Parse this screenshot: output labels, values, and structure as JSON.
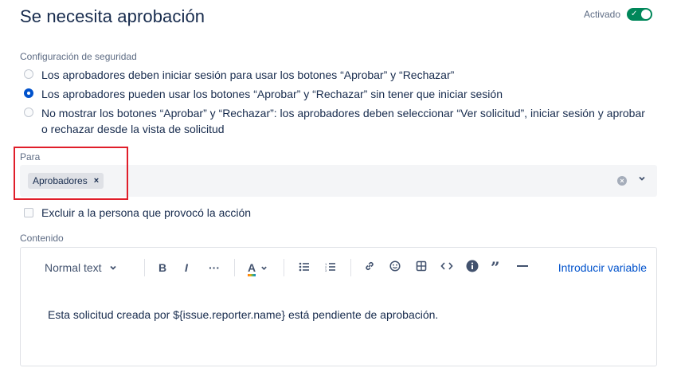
{
  "header": {
    "title": "Se necesita aprobación",
    "toggle_label": "Activado",
    "toggle_on": true
  },
  "security": {
    "label": "Configuración de seguridad",
    "options": [
      {
        "text": "Los aprobadores deben iniciar sesión para usar los botones “Aprobar” y “Rechazar”",
        "selected": false
      },
      {
        "text": "Los aprobadores pueden usar los botones “Aprobar” y “Rechazar” sin tener que iniciar sesión",
        "selected": true
      },
      {
        "text": "No mostrar los botones “Aprobar” y “Rechazar”: los aprobadores deben seleccionar “Ver solicitud”, iniciar sesión y aprobar o rechazar desde la vista de solicitud",
        "selected": false
      }
    ]
  },
  "para": {
    "label": "Para",
    "chips": [
      "Aprobadores"
    ],
    "chip_remove": "×"
  },
  "exclude": {
    "label": "Excluir a la persona que provocó la acción",
    "checked": false
  },
  "content": {
    "label": "Contenido",
    "toolbar": {
      "text_style": "Normal text",
      "insert_variable": "Introducir variable"
    },
    "body": "Esta solicitud creada por ${issue.reporter.name} está pendiente de aprobación."
  },
  "colors": {
    "accent": "#0052cc",
    "toggle": "#00875a",
    "highlight": "#e01e2a"
  }
}
